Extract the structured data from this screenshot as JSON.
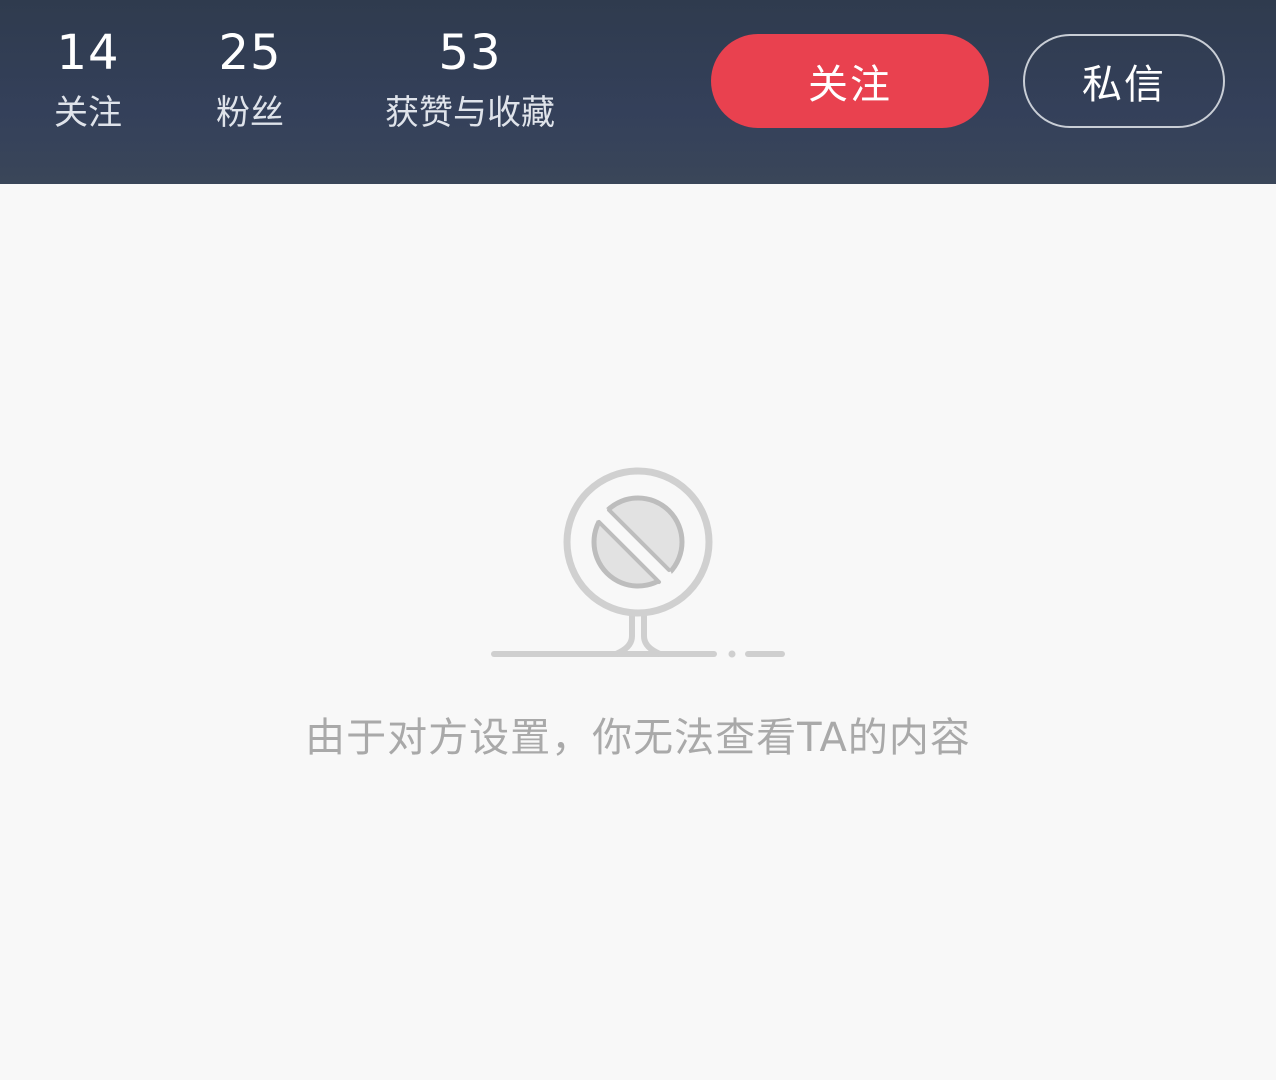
{
  "stats": [
    {
      "value": "14",
      "label": "关注"
    },
    {
      "value": "25",
      "label": "粉丝"
    },
    {
      "value": "53",
      "label": "获赞与收藏"
    }
  ],
  "actions": {
    "follow_label": "关注",
    "message_label": "私信"
  },
  "empty_state": {
    "icon": "blocked-sign-icon",
    "message": "由于对方设置，你无法查看TA的内容"
  },
  "colors": {
    "header_bg": "#34405a",
    "follow_button": "#e9414f",
    "page_bg": "#f8f8f8",
    "empty_text": "#a9a9a9"
  }
}
